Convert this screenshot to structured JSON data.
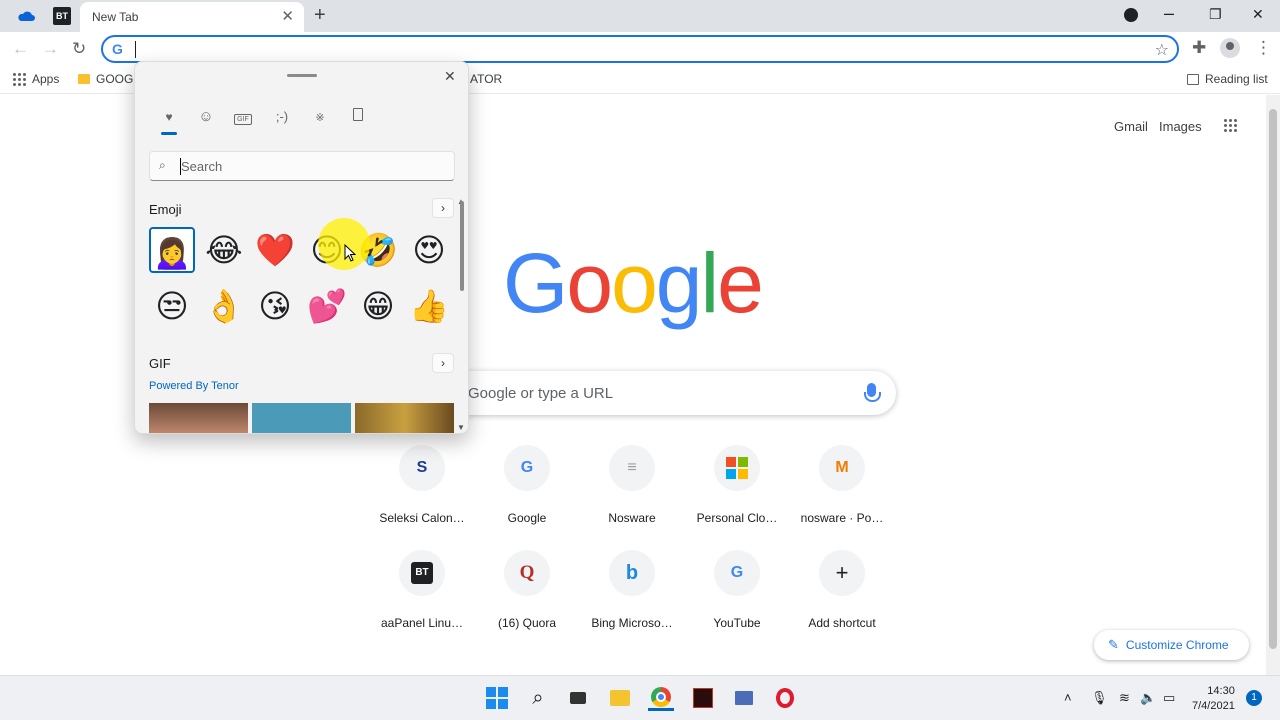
{
  "browser": {
    "pinned_tab_2": "BT",
    "active_tab_title": "New Tab",
    "tab_close": "✕",
    "new_tab": "+",
    "omnibox_icon": "G",
    "bookmarks": {
      "apps": "Apps",
      "folder_label": "GOOGL",
      "partial_label": "ATOR",
      "reading_list": "Reading list"
    }
  },
  "ntp": {
    "gmail": "Gmail",
    "images": "Images",
    "logo_letters": [
      {
        "ch": "G",
        "color": "#4285f4"
      },
      {
        "ch": "o",
        "color": "#ea4335"
      },
      {
        "ch": "o",
        "color": "#fbbc05"
      },
      {
        "ch": "g",
        "color": "#4285f4"
      },
      {
        "ch": "l",
        "color": "#34a853"
      },
      {
        "ch": "e",
        "color": "#ea4335"
      }
    ],
    "search_placeholder": "Google or type a URL",
    "shortcuts": [
      {
        "label": "Seleksi Calon…",
        "icon": "S"
      },
      {
        "label": "Google",
        "icon": "G"
      },
      {
        "label": "Nosware",
        "icon": "≡"
      },
      {
        "label": "Personal Clo…",
        "icon": "⊞"
      },
      {
        "label": "nosware · Po…",
        "icon": "M"
      },
      {
        "label": "aaPanel Linu…",
        "icon": "BT"
      },
      {
        "label": "(16) Quora",
        "icon": "Q"
      },
      {
        "label": "Bing Microso…",
        "icon": "b"
      },
      {
        "label": "YouTube",
        "icon": "G"
      },
      {
        "label": "Add shortcut",
        "icon": "+"
      }
    ],
    "customize": "Customize Chrome"
  },
  "emoji_panel": {
    "close": "✕",
    "search_placeholder": "Search",
    "emoji_heading": "Emoji",
    "gif_heading": "GIF",
    "powered_by": "Powered By Tenor",
    "arrow": "›",
    "tab_kaomoji": ";-)",
    "emojis": [
      "🙍‍♀️",
      "😂",
      "❤️",
      "😊",
      "🤣",
      "😍",
      "😒",
      "👌",
      "😘",
      "💕",
      "😁",
      "👍"
    ]
  },
  "taskbar": {
    "time": "14:30",
    "date": "7/4/2021",
    "notifications": "1"
  },
  "colors": {
    "accent": "#1a73e8",
    "win_accent": "#0067c0"
  }
}
